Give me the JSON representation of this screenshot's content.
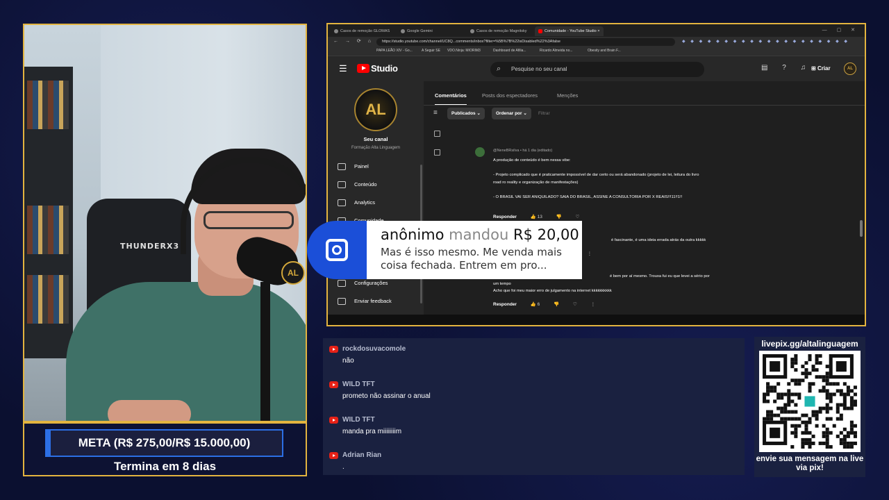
{
  "browser": {
    "tabs": [
      {
        "title": "Casos de remoção GLOMAS"
      },
      {
        "title": "Google Gemini"
      },
      {
        "title": "Casos de remoção Magnitsky"
      },
      {
        "title": "Comunidade - YouTube Studio",
        "active": true
      }
    ],
    "url": "https://studio.youtube.com/channel/UC8Q...comments/inbox?filter=%5B%7B%22isDisabled%22%3Afalse",
    "bookmarks": [
      "PAPA LEÃO XIV - Go...",
      "A Seguir SE",
      "VDO.Ninja: MIORIM3",
      "Dashboard de Afilia...",
      "Ricardo Almeida no...",
      "Obesity and Brain F..."
    ]
  },
  "studio": {
    "search_placeholder": "Pesquise no seu canal",
    "create_label": "Criar",
    "channel": {
      "logo_text": "AL",
      "title": "Seu canal",
      "name": "Formação Alta Linguagem"
    },
    "nav": [
      "Painel",
      "Conteúdo",
      "Analytics",
      "Comunidade",
      "Configurações",
      "Enviar feedback"
    ],
    "tabs": [
      "Comentários",
      "Posts dos espectadores",
      "Menções"
    ],
    "chips": {
      "published": "Publicados",
      "sort": "Ordenar por",
      "filter": "Filtrar"
    },
    "comment": {
      "author": "@NeneBRsilva",
      "time": "há 1 dia (editado)",
      "paragraphs": [
        "A produção de conteúdo é bem nessa vibe:",
        "- Projeto complicado que é praticamente impossível de dar certo ou será abandonado (projeto de lei, leitura do livro road ro reality e organização de manifestações)",
        "- O BRASIL VAI SER ANIQUILADO? SAIA DO BRASIL, ASSINE A CONSULTORIA POR X REAIS!!!11!!1!!"
      ],
      "reply_label": "Responder",
      "likes": "13"
    },
    "comment2_fragment": "é fascinante, é uma ideia errada atrás da outra kkkkk",
    "comment3": {
      "lines": [
        "é bem por aí mesmo. Trouxa fui eu que levei a sério por",
        "um tempo",
        "Acho que foi meu maior erro de julgamento na internet kkkkkkkkkk"
      ],
      "reply_label": "Responder",
      "likes": "6"
    }
  },
  "alert": {
    "donor": "anônimo",
    "verb": "mandou",
    "amount": "R$ 20,00",
    "message": "Mas é isso mesmo. Me venda mais coisa fechada. Entrem em pro..."
  },
  "goal": {
    "label": "META (R$ 275,00/R$ 15.000,00)",
    "progress_fraction": 0.018,
    "ends": "Termina em 8 dias"
  },
  "webcam": {
    "chair_brand": "THUNDERX3",
    "mic_logo": "AL"
  },
  "chat": [
    {
      "user": "rockdosuvacomole",
      "text": "não"
    },
    {
      "user": "WILD TFT",
      "text": "prometo não assinar o anual"
    },
    {
      "user": "WILD TFT",
      "text": "manda pra miiiiiiiim"
    },
    {
      "user": "Adrian Rian",
      "text": "."
    }
  ],
  "livepix": {
    "url": "livepix.gg/altalinguagem",
    "cta": "envie sua mensagem na live via pix!"
  },
  "colors": {
    "frame": "#e3b43f",
    "goal_bar": "#2c6fe5",
    "alert_icon": "#1b4fd8",
    "youtube_red": "#ff0000"
  }
}
